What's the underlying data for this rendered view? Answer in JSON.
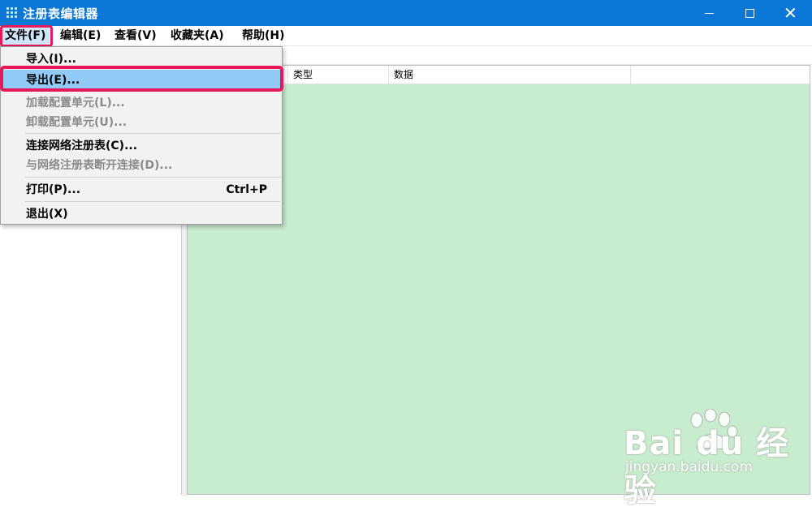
{
  "window": {
    "title": "注册表编辑器"
  },
  "menubar": {
    "items": [
      {
        "label": "文件(F)"
      },
      {
        "label": "编辑(E)"
      },
      {
        "label": "查看(V)"
      },
      {
        "label": "收藏夹(A)"
      },
      {
        "label": "帮助(H)"
      }
    ]
  },
  "list": {
    "columns": [
      "",
      "类型",
      "数据",
      ""
    ]
  },
  "file_menu": {
    "items": [
      {
        "label": "导入(I)...",
        "enabled": true
      },
      {
        "label": "导出(E)...",
        "enabled": true,
        "selected": true
      },
      {
        "label": "加载配置单元(L)...",
        "enabled": false
      },
      {
        "label": "卸载配置单元(U)...",
        "enabled": false
      },
      {
        "label": "连接网络注册表(C)...",
        "enabled": true
      },
      {
        "label": "与网络注册表断开连接(D)...",
        "enabled": false
      },
      {
        "label": "打印(P)...",
        "shortcut": "Ctrl+P",
        "enabled": true
      },
      {
        "label": "退出(X)",
        "enabled": true
      }
    ]
  },
  "colors": {
    "titlebar": "#0b78d7",
    "highlight_box": "#e8185a",
    "selected_item": "#91c9f7",
    "list_background": "#c8ecce"
  },
  "watermark": {
    "brand": "Bai du 经验",
    "url": "jingyan.baidu.com"
  }
}
